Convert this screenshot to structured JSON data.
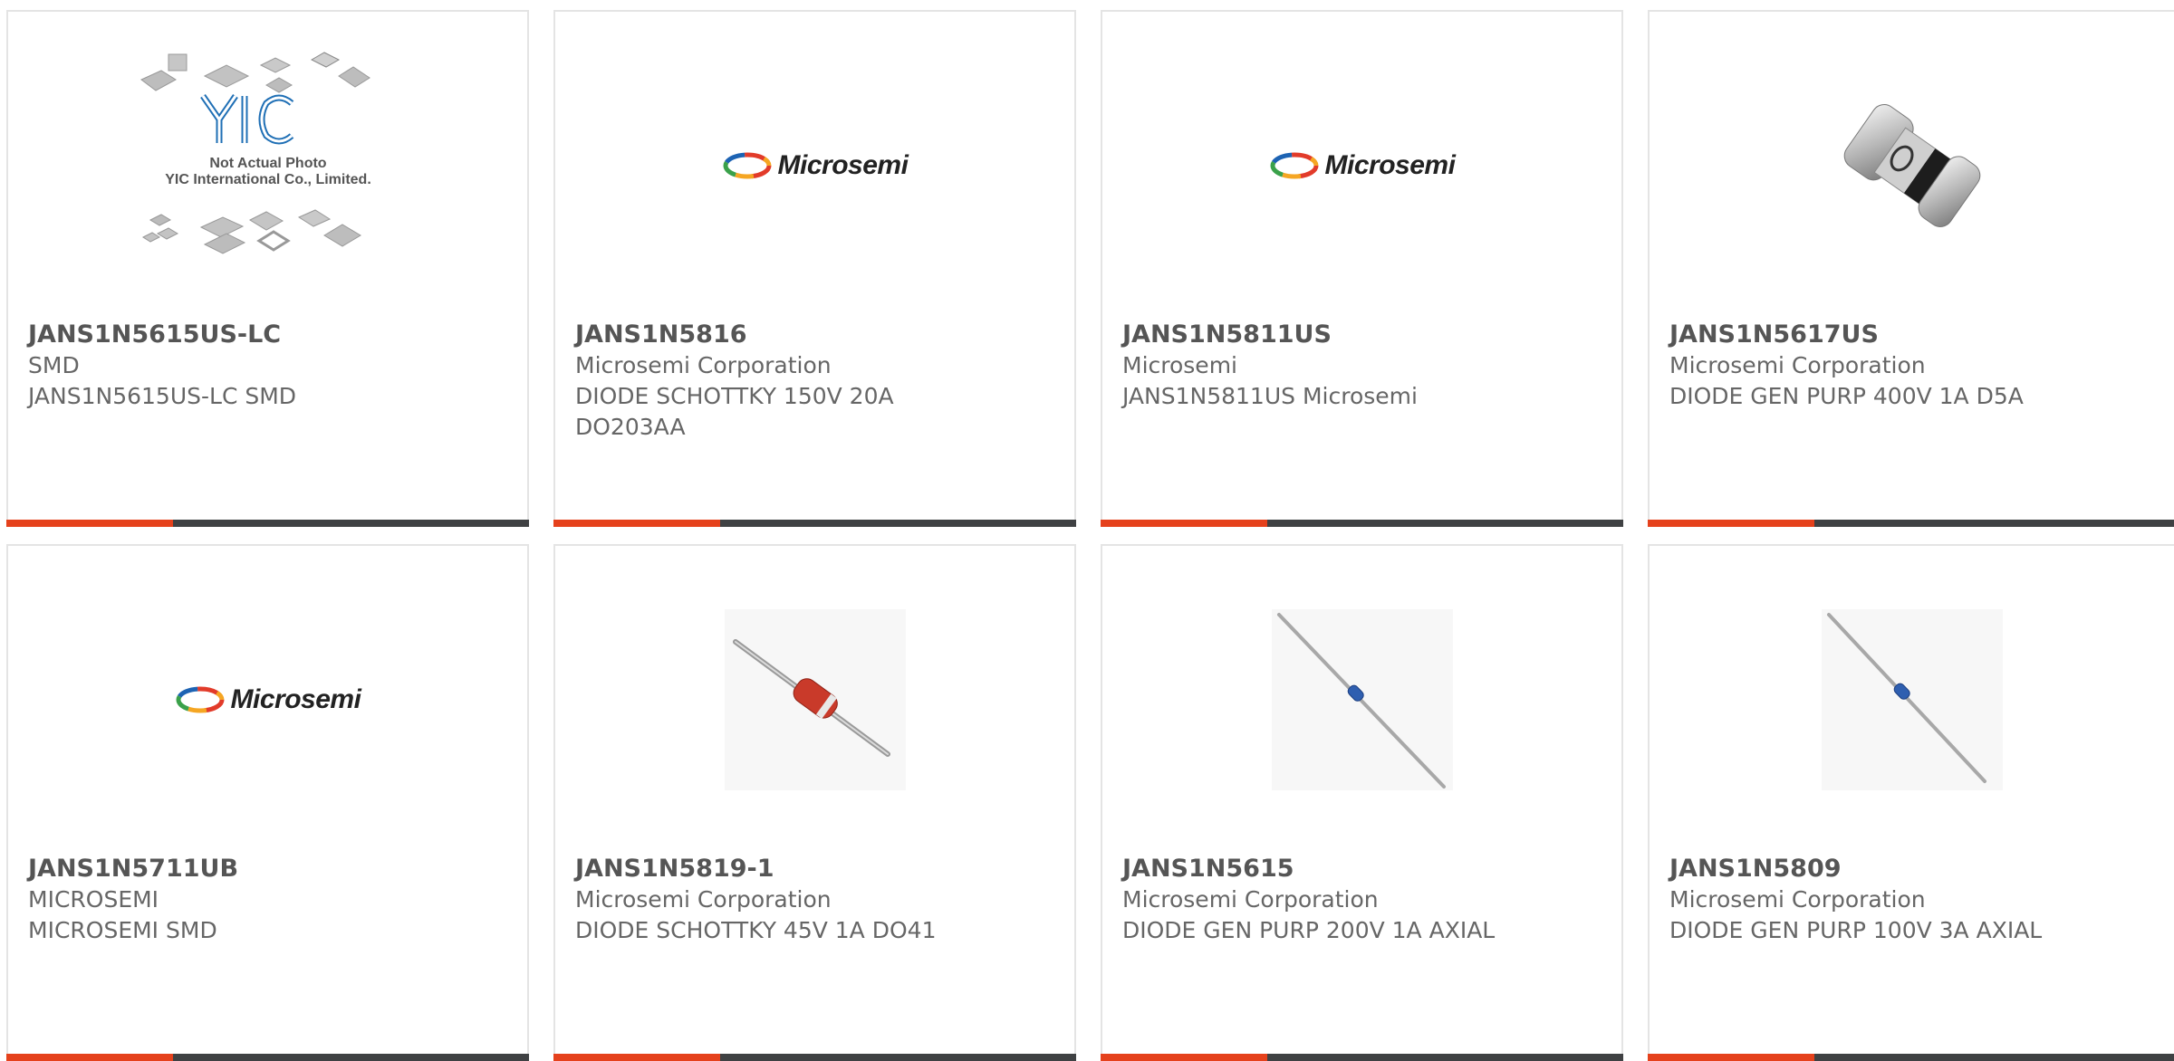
{
  "products": [
    {
      "part": "JANS1N5615US-LC",
      "manufacturer": "SMD",
      "description": "JANS1N5615US-LC SMD",
      "image": "yic-placeholder",
      "placeholder": {
        "brand": "YIC",
        "line1": "Not Actual Photo",
        "line2": "YIC International Co., Limited."
      }
    },
    {
      "part": "JANS1N5816",
      "manufacturer": "Microsemi Corporation",
      "description": "DIODE SCHOTTKY 150V 20A DO203AA",
      "image": "microsemi-logo",
      "logo_text": "Microsemi"
    },
    {
      "part": "JANS1N5811US",
      "manufacturer": "Microsemi",
      "description": "JANS1N5811US Microsemi",
      "image": "microsemi-logo",
      "logo_text": "Microsemi"
    },
    {
      "part": "JANS1N5617US",
      "manufacturer": "Microsemi Corporation",
      "description": "DIODE GEN PURP 400V 1A D5A",
      "image": "d5a-diode-photo"
    },
    {
      "part": "JANS1N5711UB",
      "manufacturer": "MICROSEMI",
      "description": "MICROSEMI SMD",
      "image": "microsemi-logo",
      "logo_text": "Microsemi"
    },
    {
      "part": "JANS1N5819-1",
      "manufacturer": "Microsemi Corporation",
      "description": "DIODE SCHOTTKY 45V 1A DO41",
      "image": "do41-diode-photo"
    },
    {
      "part": "JANS1N5615",
      "manufacturer": "Microsemi Corporation",
      "description": "DIODE GEN PURP 200V 1A AXIAL",
      "image": "axial-diode-photo"
    },
    {
      "part": "JANS1N5809",
      "manufacturer": "Microsemi Corporation",
      "description": "DIODE GEN PURP 100V 3A AXIAL",
      "image": "axial-diode-photo"
    }
  ],
  "colors": {
    "accent": "#e5411c",
    "bar": "#3f4143",
    "text": "#666666"
  }
}
